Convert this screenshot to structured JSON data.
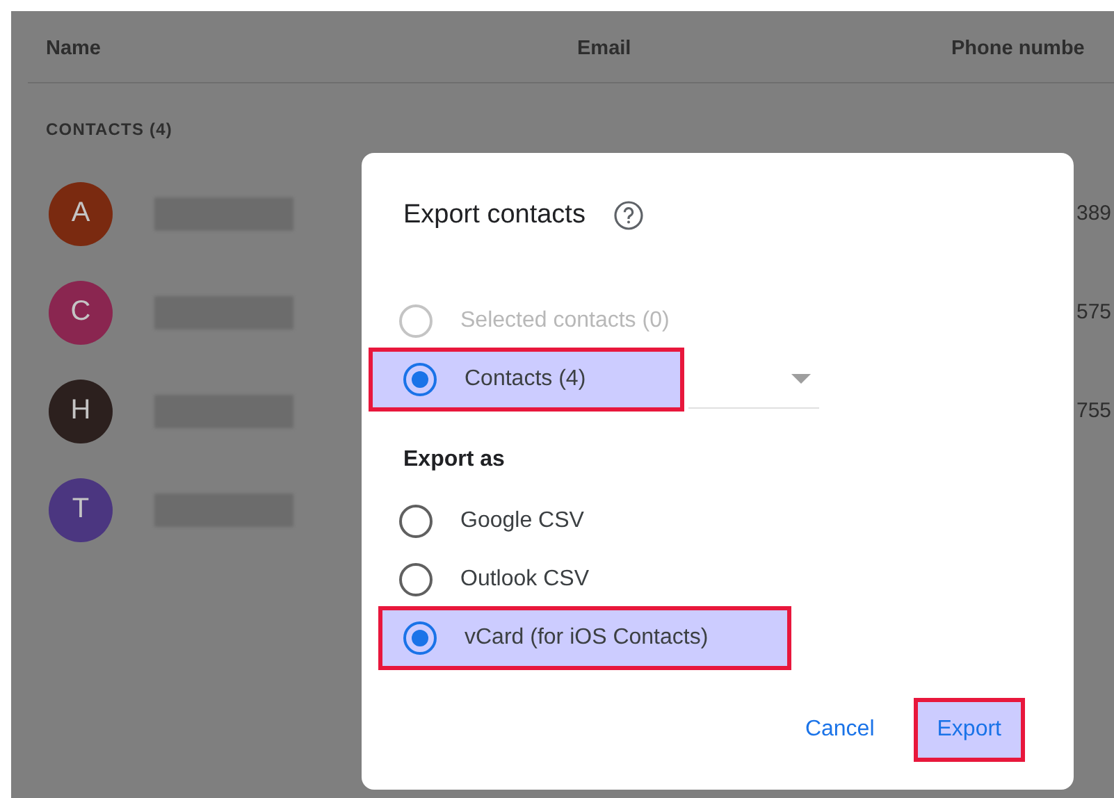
{
  "header": {
    "columns": [
      "Name",
      "Email",
      "Phone numbe"
    ]
  },
  "list": {
    "section_label": "CONTACTS (4)",
    "contacts": [
      {
        "initial": "A",
        "color": "#7a2a10",
        "phone": "389"
      },
      {
        "initial": "C",
        "color": "#8a2650",
        "phone": "575"
      },
      {
        "initial": "H",
        "color": "#2c201e",
        "phone": "755"
      },
      {
        "initial": "T",
        "color": "#4b3680"
      }
    ]
  },
  "dialog": {
    "title": "Export contacts",
    "scope_options": [
      {
        "label": "Selected contacts (0)",
        "selected": false,
        "disabled": true,
        "highlighted": false
      },
      {
        "label": "Contacts (4)",
        "selected": true,
        "disabled": false,
        "highlighted": true
      }
    ],
    "format_heading": "Export as",
    "format_options": [
      {
        "label": "Google CSV",
        "selected": false,
        "highlighted": false
      },
      {
        "label": "Outlook CSV",
        "selected": false,
        "highlighted": false
      },
      {
        "label": "vCard (for iOS Contacts)",
        "selected": true,
        "highlighted": true
      }
    ],
    "buttons": [
      {
        "label": "Cancel",
        "highlighted": false
      },
      {
        "label": "Export",
        "highlighted": true
      }
    ]
  }
}
